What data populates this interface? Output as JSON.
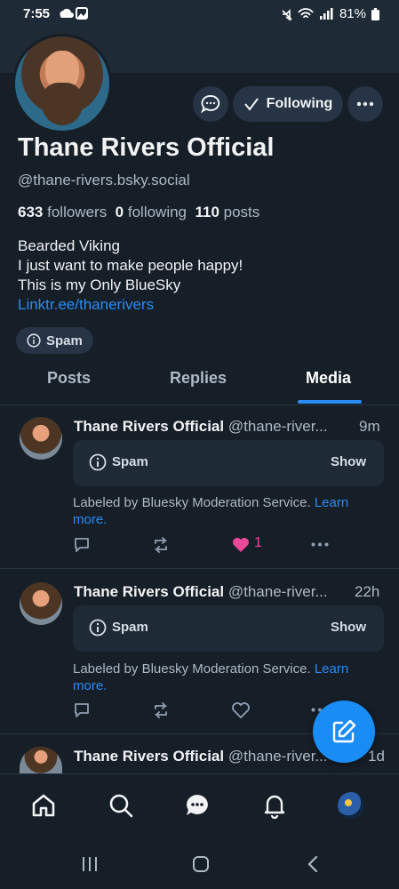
{
  "status_bar": {
    "time": "7:55",
    "battery": "81%"
  },
  "profile": {
    "name": "Thane Rivers Official",
    "handle": "@thane-rivers.bsky.social",
    "followers_count": "633",
    "followers_label": "followers",
    "following_count": "0",
    "following_label": "following",
    "posts_count": "110",
    "posts_label": "posts",
    "bio": [
      "Bearded Viking",
      "I just want to make people happy!",
      "This is my Only BlueSky"
    ],
    "link": "Linktr.ee/thanerivers",
    "label_chip": "Spam",
    "following_button": "Following"
  },
  "tabs": [
    {
      "label": "Posts",
      "active": false
    },
    {
      "label": "Replies",
      "active": false
    },
    {
      "label": "Media",
      "active": true
    }
  ],
  "posts": [
    {
      "author": "Thane Rivers Official",
      "handle": "@thane-river...",
      "time": "9m",
      "warning_label": "Spam",
      "show_label": "Show",
      "labeled_text": "Labeled by Bluesky Moderation Service.",
      "learn_more_a": "Learn",
      "learn_more_b": "more.",
      "likes": "1",
      "liked": true
    },
    {
      "author": "Thane Rivers Official",
      "handle": "@thane-river...",
      "time": "22h",
      "warning_label": "Spam",
      "show_label": "Show",
      "labeled_text": "Labeled by Bluesky Moderation Service.",
      "learn_more_a": "Learn",
      "learn_more_b": "more.",
      "likes": "",
      "liked": false
    },
    {
      "author": "Thane Rivers Official",
      "handle": "@thane-river...",
      "time": "1d"
    }
  ],
  "colors": {
    "background": "#161e27",
    "surface": "#1e2a36",
    "accent": "#2a8cf5",
    "like": "#ec4899"
  },
  "icons": [
    "chat-icon",
    "check-icon",
    "more-icon",
    "info-icon",
    "reply-icon",
    "repost-icon",
    "heart-icon",
    "compose-icon",
    "home-icon",
    "search-icon",
    "messages-icon",
    "bell-icon",
    "avatar"
  ]
}
